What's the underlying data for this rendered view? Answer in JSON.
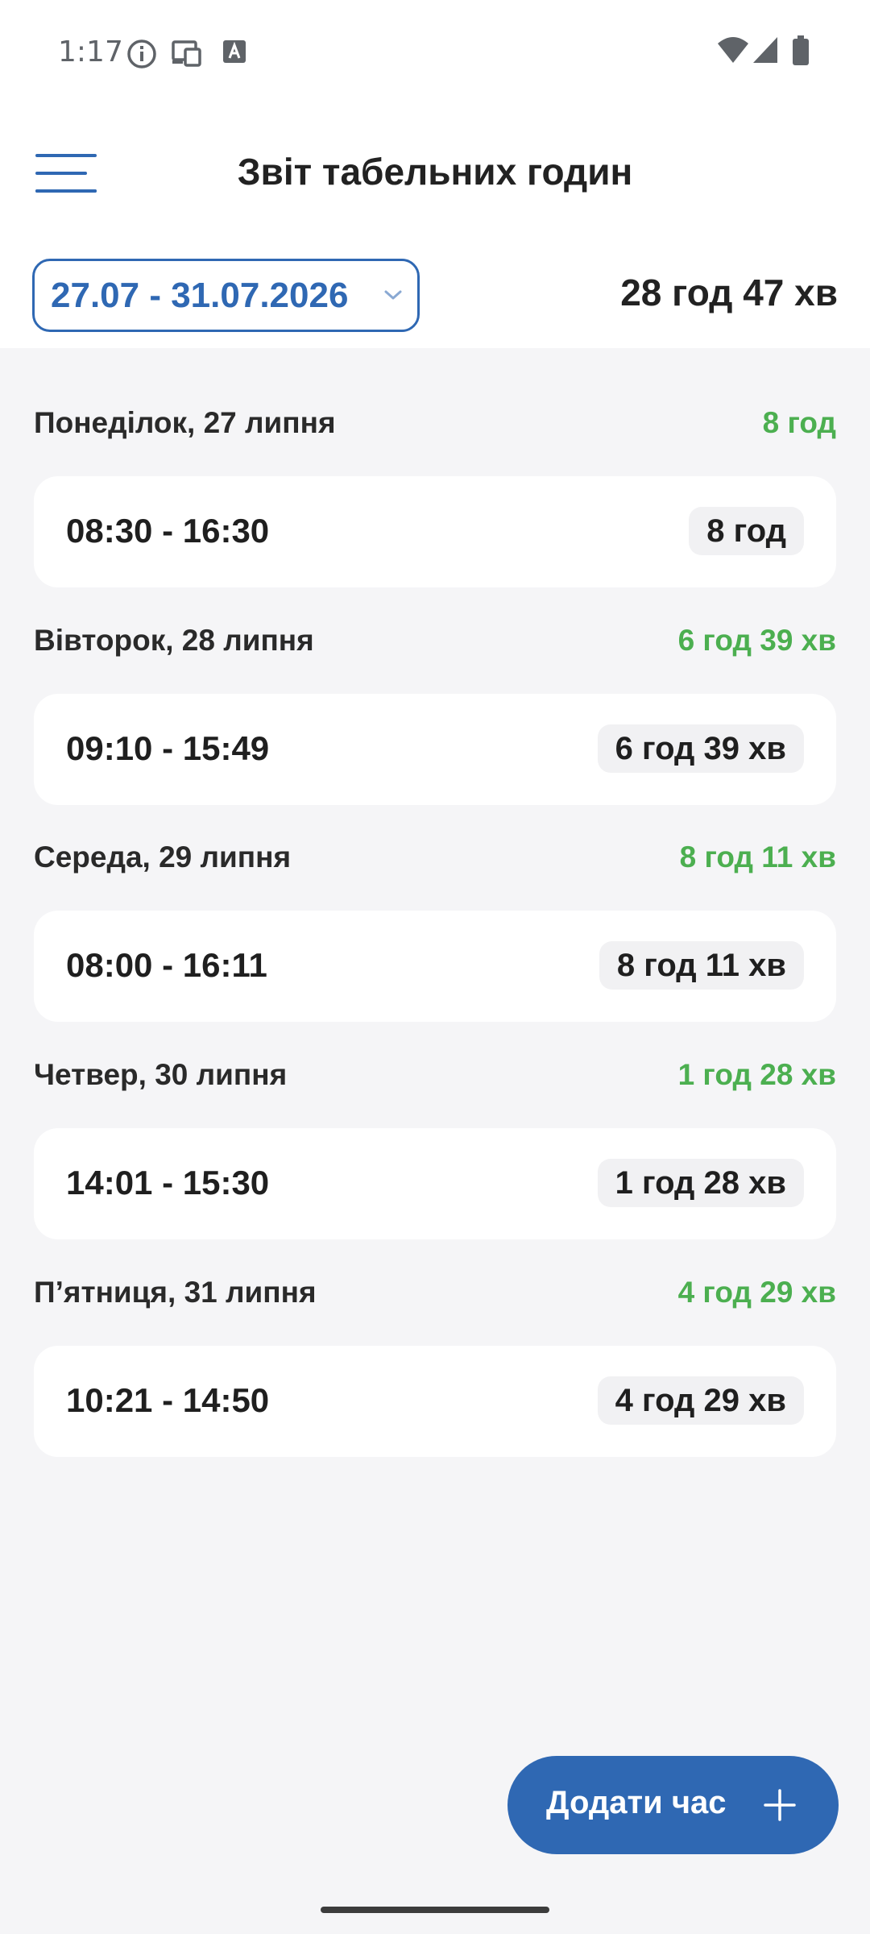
{
  "status_bar": {
    "time": "1:17",
    "icons": [
      "info-icon",
      "cast-icon",
      "keyboard-a-icon",
      "wifi-icon",
      "signal-icon",
      "battery-icon"
    ]
  },
  "header": {
    "title": "Звіт табельних годин",
    "menu_icon": "menu-icon"
  },
  "range": {
    "label": "27.07 - 31.07.2026",
    "total": "28 год 47 хв"
  },
  "days": [
    {
      "label": "Понеділок, 27 липня",
      "total": "8 год",
      "entry_range": "08:30 - 16:30",
      "entry_duration": "8 год"
    },
    {
      "label": "Вівторок, 28 липня",
      "total": "6 год 39 хв",
      "entry_range": "09:10 - 15:49",
      "entry_duration": "6 год 39 хв"
    },
    {
      "label": "Середа, 29 липня",
      "total": "8 год 11 хв",
      "entry_range": "08:00 - 16:11",
      "entry_duration": "8 год 11 хв"
    },
    {
      "label": "Четвер, 30 липня",
      "total": "1 год 28 хв",
      "entry_range": "14:01 - 15:30",
      "entry_duration": "1 год 28 хв"
    },
    {
      "label": "П’ятниця, 31 липня",
      "total": "4 год 29 хв",
      "entry_range": "10:21 - 14:50",
      "entry_duration": "4 год 29 хв"
    }
  ],
  "fab": {
    "label": "Додати час",
    "icon": "plus-icon"
  },
  "colors": {
    "accent": "#2f68b3",
    "positive": "#4caf50",
    "background": "#f5f5f7",
    "card": "#ffffff"
  }
}
